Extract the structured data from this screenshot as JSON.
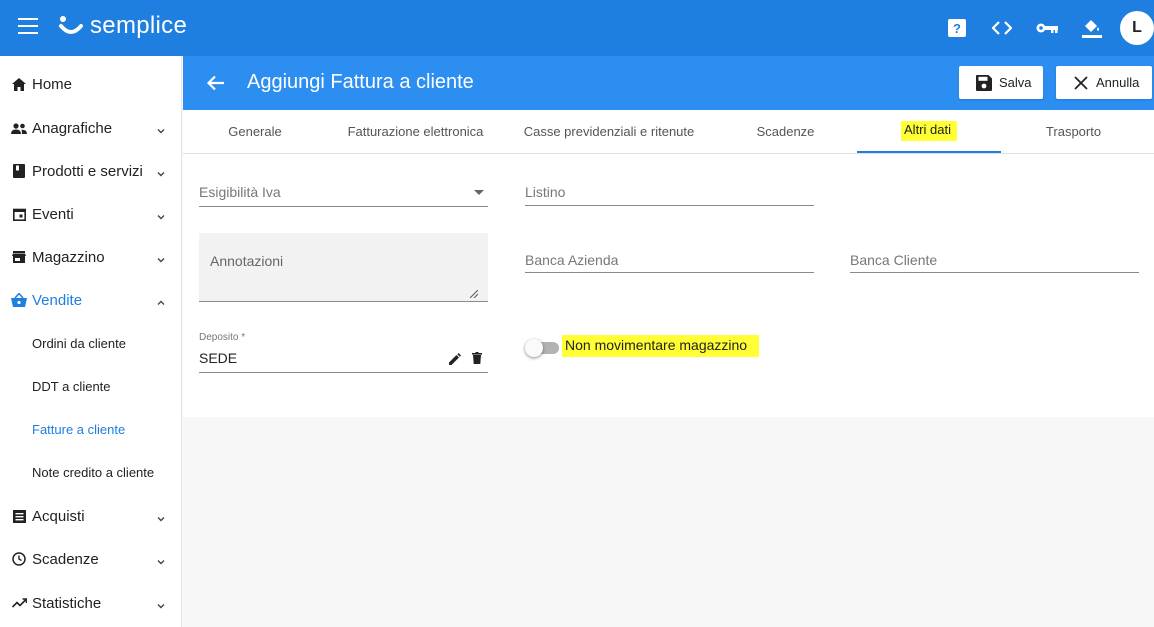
{
  "app": {
    "brand": "semplice",
    "colors": {
      "primary": "#1e7fe0",
      "header": "#2c8ef0",
      "highlight": "#ffff33"
    },
    "topbar_icons": [
      "help-icon",
      "code-icon",
      "key-icon",
      "paint-bucket-icon"
    ],
    "avatar_initial": "L"
  },
  "sidebar": {
    "items": [
      {
        "label": "Home",
        "icon": "home-icon",
        "expandable": false
      },
      {
        "label": "Anagrafiche",
        "icon": "people-icon",
        "expandable": true
      },
      {
        "label": "Prodotti e servizi",
        "icon": "book-icon",
        "expandable": true
      },
      {
        "label": "Eventi",
        "icon": "calendar-icon",
        "expandable": true
      },
      {
        "label": "Magazzino",
        "icon": "store-icon",
        "expandable": true
      },
      {
        "label": "Vendite",
        "icon": "basket-icon",
        "expandable": true,
        "expanded": true
      },
      {
        "label": "Acquisti",
        "icon": "list-icon",
        "expandable": true
      },
      {
        "label": "Scadenze",
        "icon": "clock-icon",
        "expandable": true
      },
      {
        "label": "Statistiche",
        "icon": "trending-icon",
        "expandable": true
      }
    ],
    "vendite_subitems": [
      {
        "label": "Ordini da cliente"
      },
      {
        "label": "DDT a cliente"
      },
      {
        "label": "Fatture a cliente",
        "active": true
      },
      {
        "label": "Note credito a cliente"
      }
    ]
  },
  "header": {
    "title": "Aggiungi Fattura a cliente",
    "save_label": "Salva",
    "cancel_label": "Annulla"
  },
  "tabs": [
    {
      "label": "Generale"
    },
    {
      "label": "Fatturazione elettronica"
    },
    {
      "label": "Casse previdenziali e ritenute"
    },
    {
      "label": "Scadenze"
    },
    {
      "label": "Altri dati",
      "active": true
    },
    {
      "label": "Trasporto"
    }
  ],
  "form": {
    "esigibilita_iva": {
      "label": "Esigibilità Iva",
      "value": ""
    },
    "listino": {
      "label": "Listino",
      "value": ""
    },
    "annotazioni": {
      "label": "Annotazioni",
      "value": ""
    },
    "banca_azienda": {
      "label": "Banca Azienda",
      "value": ""
    },
    "banca_cliente": {
      "label": "Banca Cliente",
      "value": ""
    },
    "deposito": {
      "label": "Deposito *",
      "value": "SEDE"
    },
    "non_movimentare": {
      "label": "Non movimentare magazzino",
      "checked": false
    }
  }
}
